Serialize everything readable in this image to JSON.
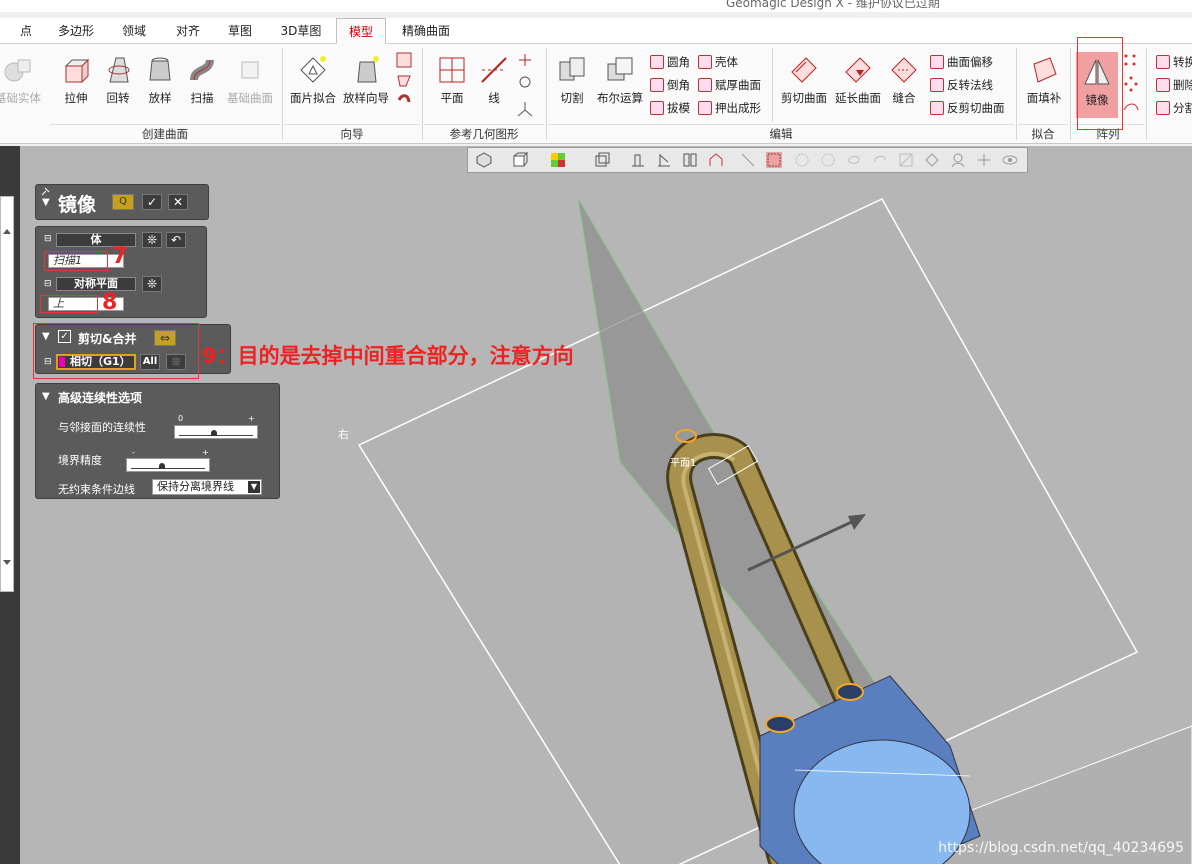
{
  "app": {
    "title": "Geomagic Design X - 维护协议已过期"
  },
  "tabs": [
    "点",
    "多边形",
    "领域",
    "对齐",
    "草图",
    "3D草图",
    "模型",
    "精确曲面"
  ],
  "active_tab": "模型",
  "ribbon": {
    "create": [
      "基础实体",
      "拉伸",
      "回转",
      "放样",
      "扫描",
      "基础曲面"
    ],
    "create_group": "创建曲面",
    "wizard": [
      "面片拟合",
      "放样向导"
    ],
    "wizard_group": "向导",
    "refgeo": [
      "平面",
      "线"
    ],
    "refgeo_group": "参考几何图形",
    "edit_big": [
      "切割",
      "布尔运算"
    ],
    "edit_small": [
      "圆角",
      "壳体",
      "倒角",
      "赋厚曲面",
      "拔模",
      "押出成形"
    ],
    "edit_big2": [
      "剪切曲面",
      "延长曲面",
      "缝合"
    ],
    "edit_small2": [
      "曲面偏移",
      "反转法线",
      "反剪切曲面"
    ],
    "edit_group": "编辑",
    "fit": [
      "面填补"
    ],
    "fit_group": "拟合",
    "pattern": [
      "镜像"
    ],
    "pattern_group": "阵列",
    "right": [
      "转换",
      "删除",
      "分割"
    ]
  },
  "panel": {
    "title": "镜像",
    "body_label": "体",
    "body_value": "扫描1",
    "sym_label": "对称平面",
    "sym_value": "上",
    "cut_label": "剪切&合并",
    "tangent_label": "相切（G1）",
    "all_label": "All",
    "adv_title": "高级连续性选项",
    "adj_label": "与邻接面的连续性",
    "bound_label": "境界精度",
    "unc_label": "无约束条件边线",
    "unc_value": "保持分离境界线",
    "slider_min": "0",
    "slider_max": "+",
    "slider_min2": "-",
    "slider_max2": "+"
  },
  "annotations": {
    "n6": "6",
    "n7": "7",
    "n8": "8",
    "n9": "9：目的是去掉中间重合部分，注意方向"
  },
  "viewport": {
    "label_right": "右",
    "label_plane": "平面1",
    "watermark": "https://blog.csdn.net/qq_40234695"
  },
  "colors": {
    "accent": "#c00000",
    "panel": "#5b5b5b",
    "viewport": "#b6b6b6",
    "highlight": "#e88"
  }
}
